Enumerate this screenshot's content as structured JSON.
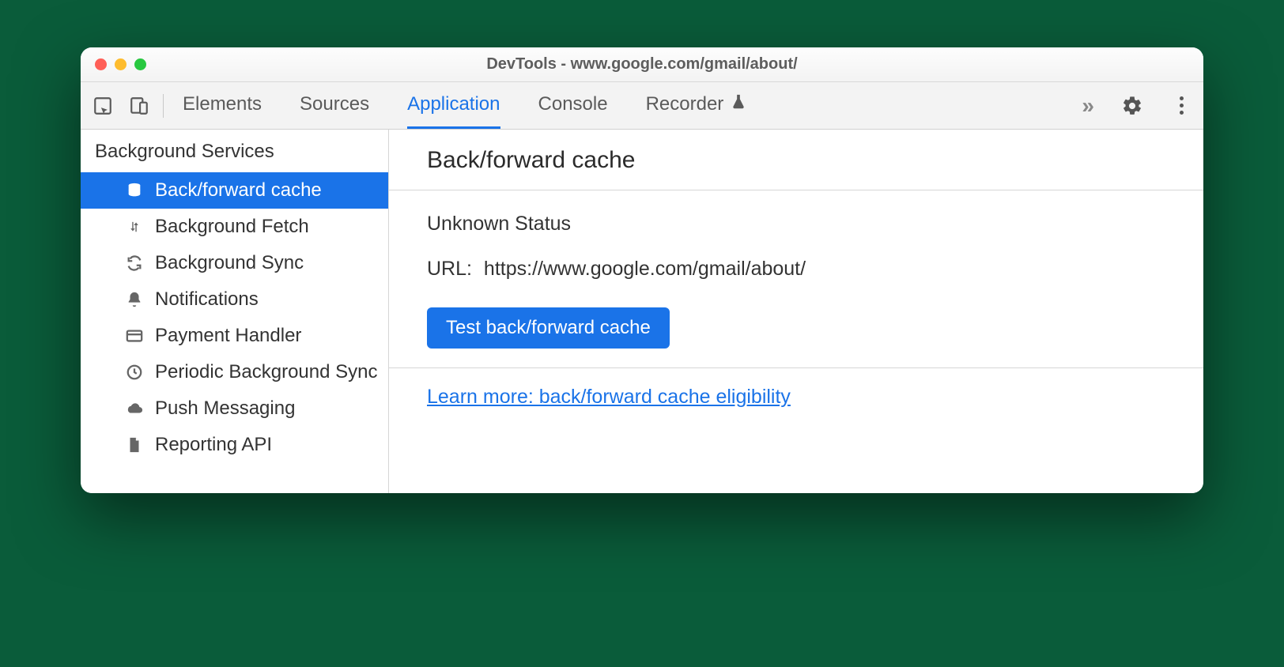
{
  "window": {
    "title": "DevTools - www.google.com/gmail/about/"
  },
  "toolbar": {
    "tabs": [
      {
        "label": "Elements",
        "active": false
      },
      {
        "label": "Sources",
        "active": false
      },
      {
        "label": "Application",
        "active": true
      },
      {
        "label": "Console",
        "active": false
      },
      {
        "label": "Recorder",
        "active": false,
        "beta": true
      }
    ]
  },
  "sidebar": {
    "section": "Background Services",
    "items": [
      {
        "label": "Back/forward cache",
        "icon": "database",
        "active": true
      },
      {
        "label": "Background Fetch",
        "icon": "updown",
        "active": false
      },
      {
        "label": "Background Sync",
        "icon": "sync",
        "active": false
      },
      {
        "label": "Notifications",
        "icon": "bell",
        "active": false
      },
      {
        "label": "Payment Handler",
        "icon": "card",
        "active": false
      },
      {
        "label": "Periodic Background Sync",
        "icon": "clock",
        "active": false
      },
      {
        "label": "Push Messaging",
        "icon": "cloud",
        "active": false
      },
      {
        "label": "Reporting API",
        "icon": "file",
        "active": false
      }
    ]
  },
  "main": {
    "heading": "Back/forward cache",
    "status": "Unknown Status",
    "url_label": "URL:",
    "url_value": "https://www.google.com/gmail/about/",
    "test_button": "Test back/forward cache",
    "learn_more": "Learn more: back/forward cache eligibility"
  }
}
